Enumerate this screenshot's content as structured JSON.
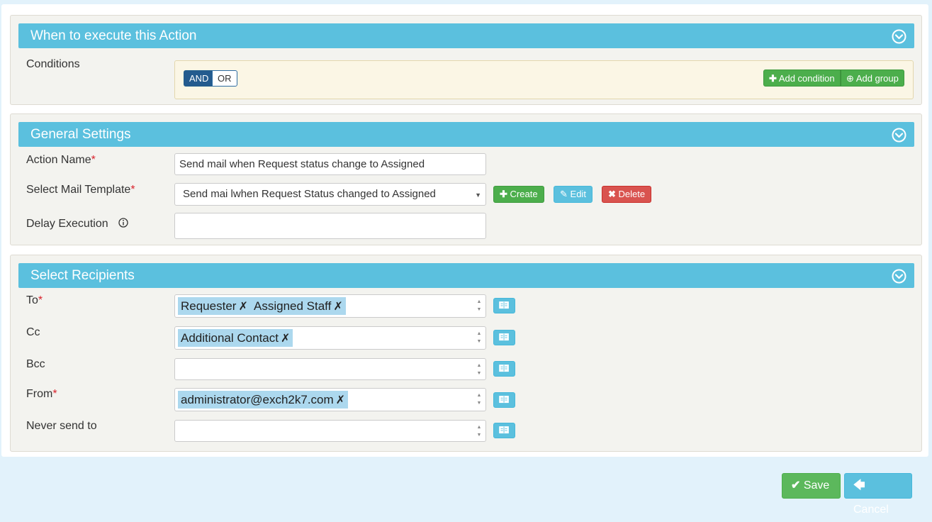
{
  "when_panel": {
    "title": "When to execute this Action",
    "conditions_label": "Conditions",
    "and_label": "AND",
    "or_label": "OR",
    "add_condition_label": "Add condition",
    "add_group_label": "Add group"
  },
  "general_panel": {
    "title": "General Settings",
    "action_name_label": "Action Name",
    "action_name_value": "Send mail when Request status change to Assigned",
    "mail_template_label": "Select Mail Template",
    "mail_template_value": "Send mai lwhen Request Status changed to Assigned",
    "create_label": "Create",
    "edit_label": "Edit",
    "delete_label": "Delete",
    "delay_label": "Delay Execution",
    "delay_value": ""
  },
  "recipients_panel": {
    "title": "Select Recipients",
    "to_label": "To",
    "to_tags": [
      "Requester",
      "Assigned Staff"
    ],
    "cc_label": "Cc",
    "cc_tags": [
      "Additional Contact"
    ],
    "bcc_label": "Bcc",
    "from_label": "From",
    "from_tags": [
      "administrator@exch2k7.com"
    ],
    "never_label": "Never send to"
  },
  "required_marker": "*",
  "tag_remove_glyph": "✗",
  "footer": {
    "save_label": "Save",
    "cancel_label": "Cancel"
  },
  "colors": {
    "panel_header": "#5bc0de",
    "success": "#5cb85c",
    "info": "#5bc0de",
    "danger": "#d9534f",
    "primary": "#245b8e"
  }
}
